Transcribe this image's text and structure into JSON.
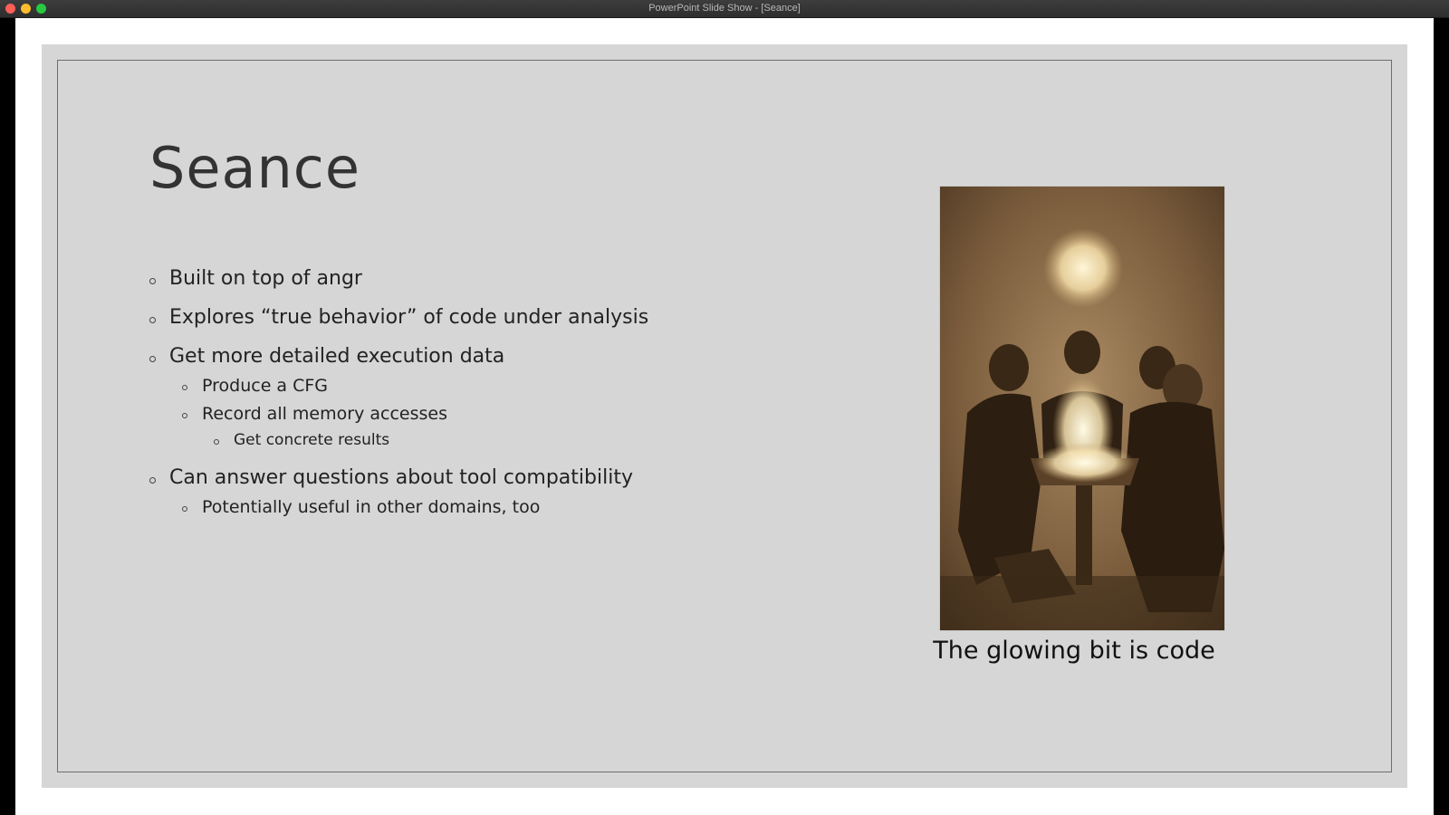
{
  "window": {
    "title": "PowerPoint Slide Show - [Seance]"
  },
  "slide": {
    "title": "Seance",
    "bullets": [
      {
        "text": "Built on top of angr"
      },
      {
        "text": "Explores “true behavior” of code under analysis"
      },
      {
        "text": "Get more detailed execution data",
        "children": [
          {
            "text": "Produce a CFG"
          },
          {
            "text": "Record all memory accesses",
            "children": [
              {
                "text": "Get concrete results"
              }
            ]
          }
        ]
      },
      {
        "text": "Can answer questions about tool compatibility",
        "children": [
          {
            "text": "Potentially useful in other domains, too"
          }
        ]
      }
    ],
    "image": {
      "subject": "sepia photograph of a seance with a glowing light above figures around a table",
      "icon": "seance-photo"
    },
    "caption": "The glowing bit is code"
  },
  "colors": {
    "slide_background": "#d6d6d6",
    "photo_sepia": "#8a6a45"
  }
}
